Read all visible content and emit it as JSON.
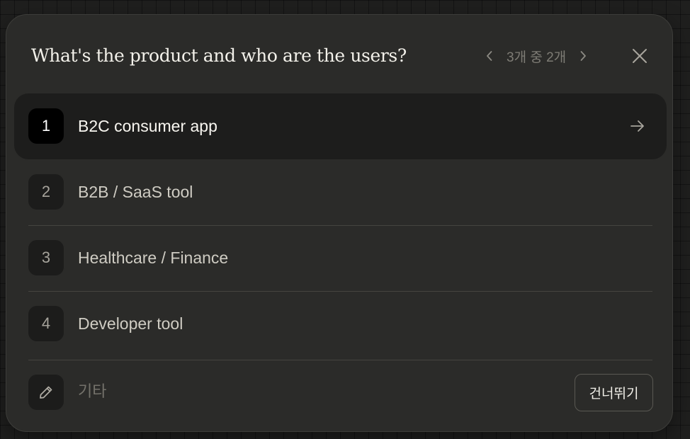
{
  "dialog": {
    "title": "What's the product and who are the users?",
    "pager": {
      "label": "3개 중 2개",
      "prev_icon": "chevron-left-icon",
      "next_icon": "chevron-right-icon"
    },
    "close_icon": "close-icon"
  },
  "options": [
    {
      "number": "1",
      "label": "B2C consumer app",
      "selected": true
    },
    {
      "number": "2",
      "label": "B2B / SaaS tool",
      "selected": false
    },
    {
      "number": "3",
      "label": "Healthcare / Finance",
      "selected": false
    },
    {
      "number": "4",
      "label": "Developer tool",
      "selected": false
    }
  ],
  "other": {
    "icon": "pencil-icon",
    "placeholder": "기타",
    "value": ""
  },
  "skip_label": "건너뛰기",
  "colors": {
    "dialog_bg": "#2b2b29",
    "selected_row_bg": "#1d1d1c",
    "text_primary": "#f3f1ea",
    "text_muted": "#7e7c75"
  }
}
